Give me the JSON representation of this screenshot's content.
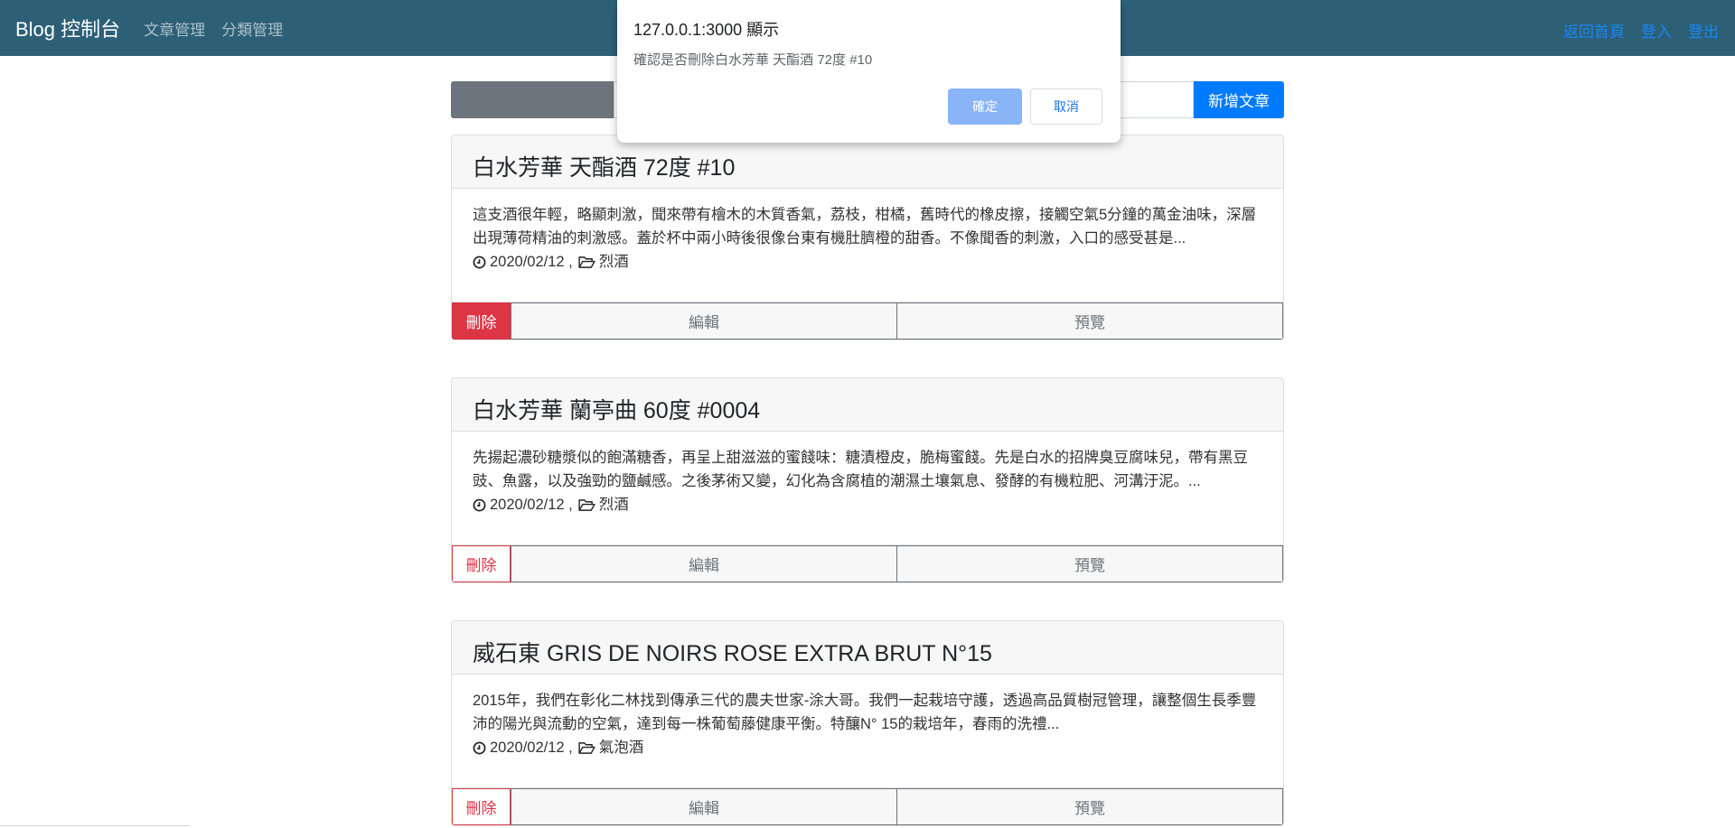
{
  "navbar": {
    "brand": "Blog 控制台",
    "left_links": [
      "文章管理",
      "分類管理"
    ],
    "right_links": [
      "返回首頁",
      "登入",
      "登出"
    ]
  },
  "toolbar": {
    "search_placeholder": "",
    "new_label": "新增文章"
  },
  "posts": [
    {
      "title": "白水芳華 天酯酒 72度 #10",
      "excerpt": "這支酒很年輕，略顯刺激，聞來帶有檜木的木質香氣，荔枝，柑橘，舊時代的橡皮擦，接觸空氣5分鐘的萬金油味，深層出現薄荷精油的刺激感。蓋於杯中兩小時後很像台東有機肚臍橙的甜香。不像聞香的刺激，入口的感受甚是...",
      "date": "2020/02/12 ,",
      "category": "烈酒",
      "delete_label": "刪除",
      "edit_label": "編輯",
      "preview_label": "預覽"
    },
    {
      "title": "白水芳華 蘭亭曲 60度 #0004",
      "excerpt": "先揚起濃砂糖漿似的飽滿糖香，再呈上甜滋滋的蜜餞味：糖漬橙皮，脆梅蜜餞。先是白水的招牌臭豆腐味兒，帶有黑豆豉、魚露，以及強勁的鹽鹹感。之後茅術又變，幻化為含腐植的潮濕土壤氣息、發酵的有機粒肥、河溝汙泥。...",
      "date": "2020/02/12 ,",
      "category": "烈酒",
      "delete_label": "刪除",
      "edit_label": "編輯",
      "preview_label": "預覽"
    },
    {
      "title": "威石東 GRIS DE NOIRS ROSE EXTRA BRUT N°15",
      "excerpt": "2015年，我們在彰化二林找到傳承三代的農夫世家-涂大哥。我們一起栽培守護，透過高品質樹冠管理，讓整個生長季豐沛的陽光與流動的空氣，達到每一株葡萄藤健康平衡。特釀N° 15的栽培年，春雨的洗禮...",
      "date": "2020/02/12 ,",
      "category": "氣泡酒",
      "delete_label": "刪除",
      "edit_label": "編輯",
      "preview_label": "預覽"
    }
  ],
  "dialog": {
    "title": "127.0.0.1:3000 顯示",
    "message": "確認是否刪除白水芳華 天酯酒 72度 #10",
    "ok_label": "確定",
    "cancel_label": "取消"
  },
  "colors": {
    "navbar": "#2d6077",
    "primary": "#007bff",
    "danger": "#dc3545",
    "secondary": "#6c757d"
  }
}
